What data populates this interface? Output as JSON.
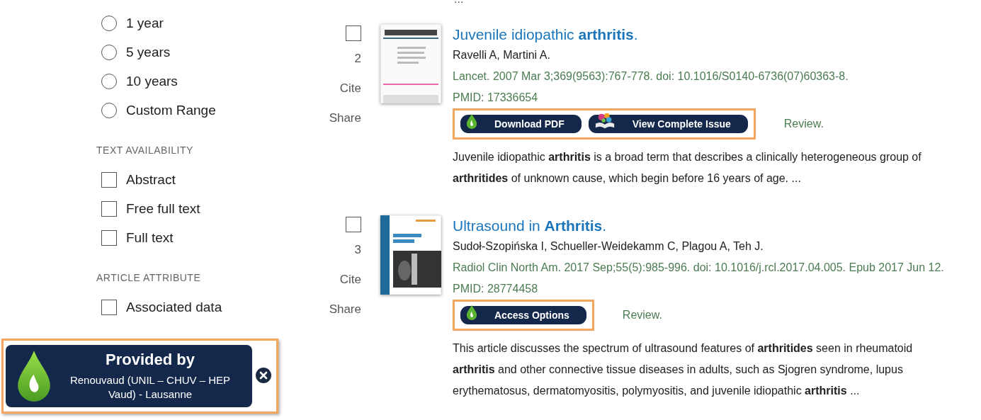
{
  "sidebar": {
    "radios": [
      {
        "label": "1 year",
        "selected": false
      },
      {
        "label": "5 years",
        "selected": false
      },
      {
        "label": "10 years",
        "selected": false
      },
      {
        "label": "Custom Range",
        "selected": false
      }
    ],
    "sections": [
      {
        "heading": "TEXT AVAILABILITY",
        "options": [
          {
            "label": "Abstract",
            "checked": false
          },
          {
            "label": "Free full text",
            "checked": false
          },
          {
            "label": "Full text",
            "checked": false
          }
        ]
      },
      {
        "heading": "ARTICLE ATTRIBUTE",
        "options": [
          {
            "label": "Associated data",
            "checked": false
          }
        ]
      }
    ]
  },
  "top_ellipsis": "...",
  "results": [
    {
      "checked": false,
      "number": "2",
      "cite": "Cite",
      "share": "Share",
      "title": "Juvenile idiopathic **arthritis**.",
      "authors": "Ravelli A, Martini A.",
      "citation": "Lancet. 2007 Mar 3;369(9563):767-778. doi: 10.1016/S0140-6736(07)60363-8.",
      "pmid": "PMID: 17336654",
      "buttons": [
        {
          "kind": "pdf",
          "label": "Download PDF"
        },
        {
          "kind": "issue",
          "label": "View Complete Issue"
        }
      ],
      "review": "Review.",
      "abstract": "Juvenile idiopathic **arthritis** is a broad term that describes a clinically heterogeneous group of **arthritides** of unknown cause, which begin before 16 years of age. ..."
    },
    {
      "checked": false,
      "number": "3",
      "cite": "Cite",
      "share": "Share",
      "title": "Ultrasound in **Arthritis**.",
      "authors": "Sudoł-Szopińska I, Schueller-Weidekamm C, Plagou A, Teh J.",
      "citation": "Radiol Clin North Am. 2017 Sep;55(5):985-996. doi: 10.1016/j.rcl.2017.04.005. Epub 2017 Jun 12.",
      "pmid": "PMID: 28774458",
      "buttons": [
        {
          "kind": "access",
          "label": "Access Options"
        }
      ],
      "review": "Review.",
      "abstract": "This article discusses the spectrum of ultrasound features of **arthritides** seen in rheumatoid **arthritis** and other connective tissue diseases in adults, such as Sjogren syndrome, lupus erythematosus, dermatomyositis, polymyositis, and juvenile idiopathic **arthritis** ..."
    }
  ],
  "popup": {
    "title": "Provided by",
    "text": "Renouvaud (UNIL – CHUV – HEP Vaud) - Lausanne"
  }
}
